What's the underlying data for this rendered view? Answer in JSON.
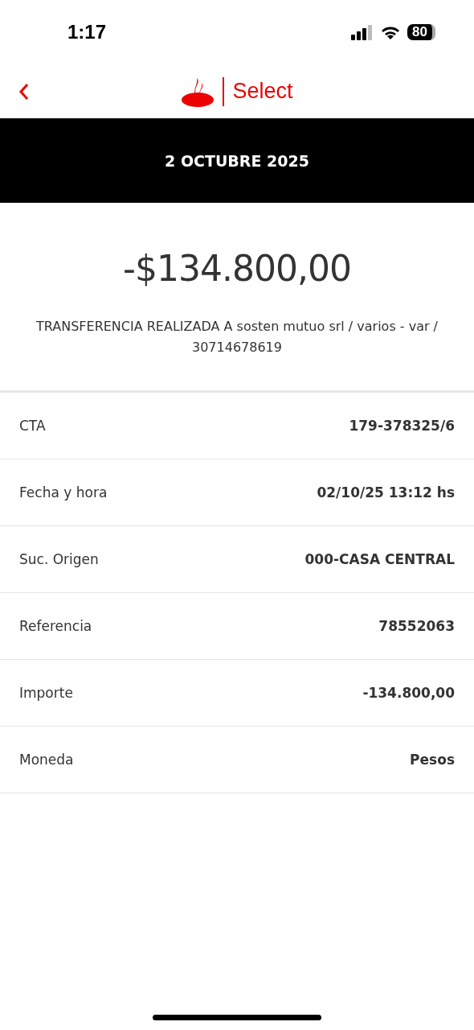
{
  "status_bar": {
    "time": "1:17",
    "battery": "80"
  },
  "header": {
    "brand": "Select"
  },
  "date_banner": "2 OCTUBRE 2025",
  "amount": "-$134.800,00",
  "description": "TRANSFERENCIA REALIZADA A sosten mutuo srl / varios - var / 30714678619",
  "details": [
    {
      "label": "CTA",
      "value": "179-378325/6"
    },
    {
      "label": "Fecha y hora",
      "value": "02/10/25 13:12 hs"
    },
    {
      "label": "Suc. Origen",
      "value": "000-CASA CENTRAL"
    },
    {
      "label": "Referencia",
      "value": "78552063"
    },
    {
      "label": "Importe",
      "value": "-134.800,00"
    },
    {
      "label": "Moneda",
      "value": "Pesos"
    }
  ]
}
